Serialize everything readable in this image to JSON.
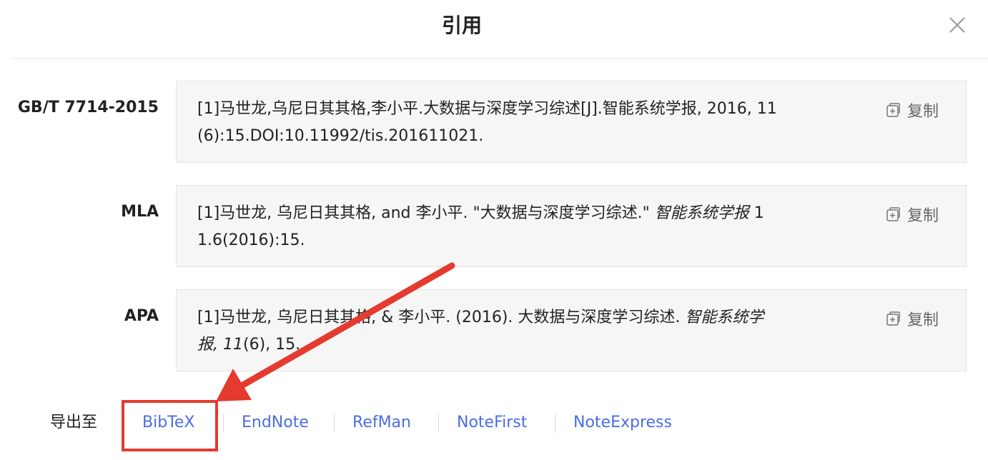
{
  "dialog": {
    "title": "引用",
    "close_icon": "close-icon"
  },
  "citations": [
    {
      "label": "GB/T 7714-2015",
      "text_line1": "[1]马世龙,乌尼日其其格,李小平.大数据与深度学习综述[J].智能系统学报, 2016, 11",
      "text_line2": "(6):15.DOI:10.11992/tis.201611021.",
      "copy_label": "复制"
    },
    {
      "label": "MLA",
      "text_line1_plain": "[1]马世龙, 乌尼日其其格, and 李小平. \"大数据与深度学习综述.\" ",
      "text_line1_italic": "智能系统学报",
      "text_line1_tail": " 1",
      "text_line2": "1.6(2016):15.",
      "copy_label": "复制"
    },
    {
      "label": "APA",
      "text_line1_plain": "[1]马世龙, 乌尼日其其格, & 李小平. (2016). 大数据与深度学习综述. ",
      "text_line1_italic": "智能系统学",
      "text_line2_italic": "报, 11",
      "text_line2_tail": "(6), 15.",
      "copy_label": "复制"
    }
  ],
  "export": {
    "label": "导出至",
    "links": [
      "BibTeX",
      "EndNote",
      "RefMan",
      "NoteFirst",
      "NoteExpress"
    ]
  },
  "colors": {
    "link": "#4a6ee0",
    "annotation": "#e53a2f",
    "box_bg": "#f6f6f6"
  },
  "annotations": {
    "highlight": "BibTeX",
    "arrow_icon": "arrow-icon"
  }
}
